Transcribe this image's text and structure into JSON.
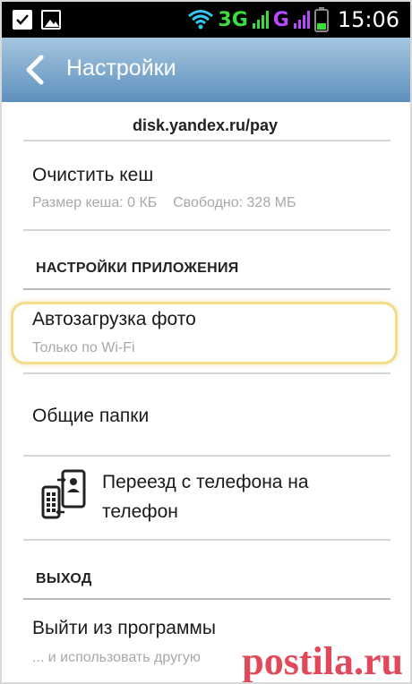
{
  "status_bar": {
    "network_1": "3G",
    "network_2": "G",
    "time": "15:06",
    "icons": [
      "check-icon",
      "image-icon",
      "wifi-icon",
      "signal-icon",
      "battery-icon"
    ]
  },
  "action_bar": {
    "title": "Настройки",
    "back_icon": "chevron-left-icon",
    "background_top": "#a6c6e0",
    "background_bottom": "#5e90bd"
  },
  "items": {
    "pay_link": "disk.yandex.ru/pay",
    "clear_cache": {
      "title": "Очистить кеш",
      "subtitle": "Размер кеша: 0 КБ    Свободно: 328 МБ"
    },
    "section_app": "НАСТРОЙКИ ПРИЛОЖЕНИЯ",
    "autoupload": {
      "title": "Автозагрузка фото",
      "subtitle": "Только по Wi-Fi"
    },
    "shared_folders": "Общие папки",
    "move_phone": {
      "line1": "Переезд с телефона на",
      "line2": "телефон",
      "icon": "phone-transfer-icon"
    },
    "section_exit": "ВЫХОД",
    "logout": {
      "title": "Выйти из программы",
      "subtitle": "... и использовать другую"
    }
  },
  "watermark": "postila.ru",
  "colors": {
    "highlight": "#f1dc8a",
    "watermark": "#dc283c"
  }
}
